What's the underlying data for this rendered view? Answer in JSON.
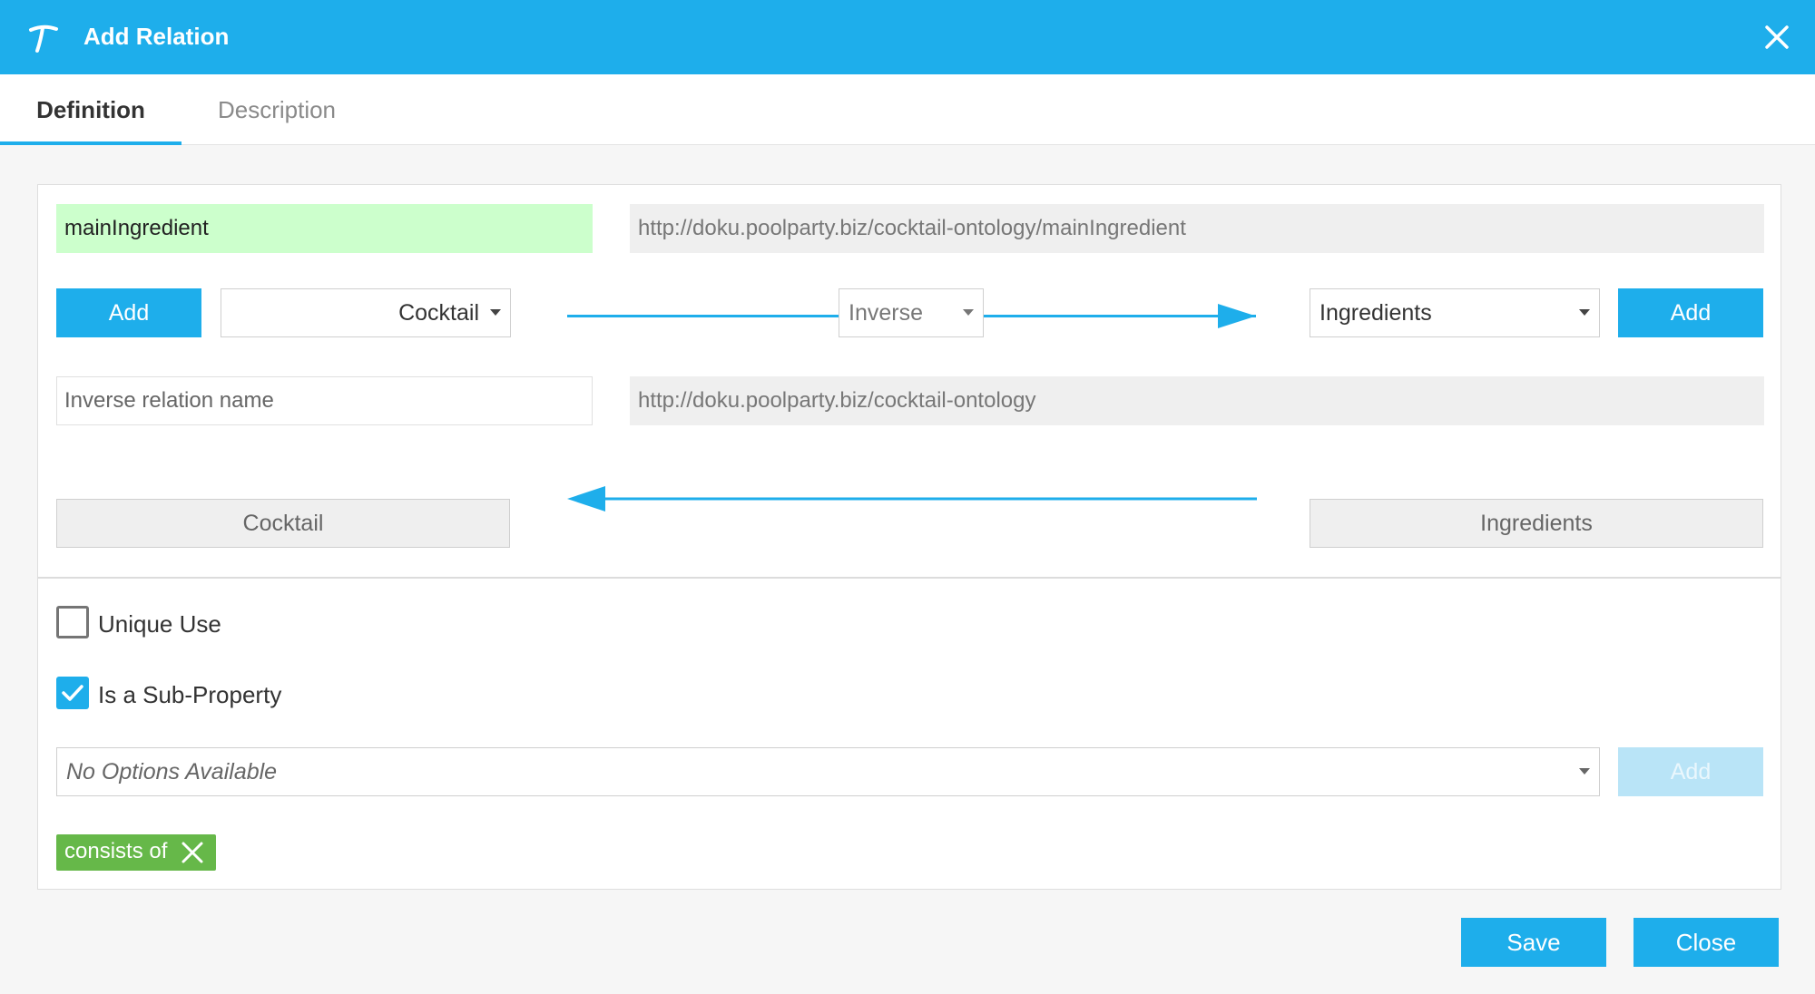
{
  "window": {
    "title": "Add Relation",
    "logo_icon": "poolparty-logo-icon",
    "close_icon": "close-icon"
  },
  "tabs": [
    {
      "label": "Definition",
      "active": true
    },
    {
      "label": "Description",
      "active": false
    }
  ],
  "relation": {
    "name": "mainIngredient",
    "uri": "http://doku.poolparty.biz/cocktail-ontology/mainIngredient",
    "add_domain_label": "Add",
    "domain_selected": "Cocktail",
    "inverse_select": "Inverse",
    "range_selected": "Ingredients",
    "add_range_label": "Add"
  },
  "inverse": {
    "name_placeholder": "Inverse relation name",
    "uri": "http://doku.poolparty.biz/cocktail-ontology",
    "domain": "Cocktail",
    "range": "Ingredients"
  },
  "options": {
    "unique_use": {
      "label": "Unique Use",
      "checked": false
    },
    "sub_property": {
      "label": "Is a Sub-Property",
      "checked": true
    },
    "super_property_select": "No Options Available",
    "add_label": "Add",
    "selected_tags": [
      {
        "label": "consists of"
      }
    ]
  },
  "footer": {
    "save_label": "Save",
    "close_label": "Close"
  },
  "colors": {
    "accent": "#1eaeeb",
    "valid_field": "#ccffcc",
    "tag": "#66b849"
  }
}
